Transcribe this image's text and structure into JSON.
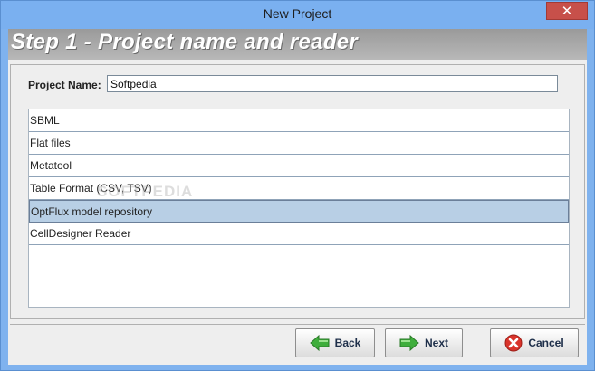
{
  "window": {
    "title": "New Project",
    "close_glyph": "✕"
  },
  "step": {
    "title": "Step 1 - Project name and reader"
  },
  "project": {
    "label": "Project Name:",
    "value": "Softpedia"
  },
  "readers": [
    {
      "label": "SBML"
    },
    {
      "label": "Flat files"
    },
    {
      "label": "Metatool"
    },
    {
      "label": "Table Format (CSV, TSV)"
    },
    {
      "label": "OptFlux model repository",
      "selected": true
    },
    {
      "label": "CellDesigner Reader"
    }
  ],
  "watermark": "SOFTPEDIA",
  "buttons": {
    "back": "Back",
    "next": "Next",
    "cancel": "Cancel"
  },
  "colors": {
    "titlebar": "#7ab0f0",
    "selection": "#b8cfe5",
    "close": "#c7504a",
    "arrow_green": "#3fae3c"
  },
  "icons": {
    "back": "green-left-arrow-icon",
    "next": "green-right-arrow-icon",
    "cancel": "red-x-circle-icon"
  }
}
